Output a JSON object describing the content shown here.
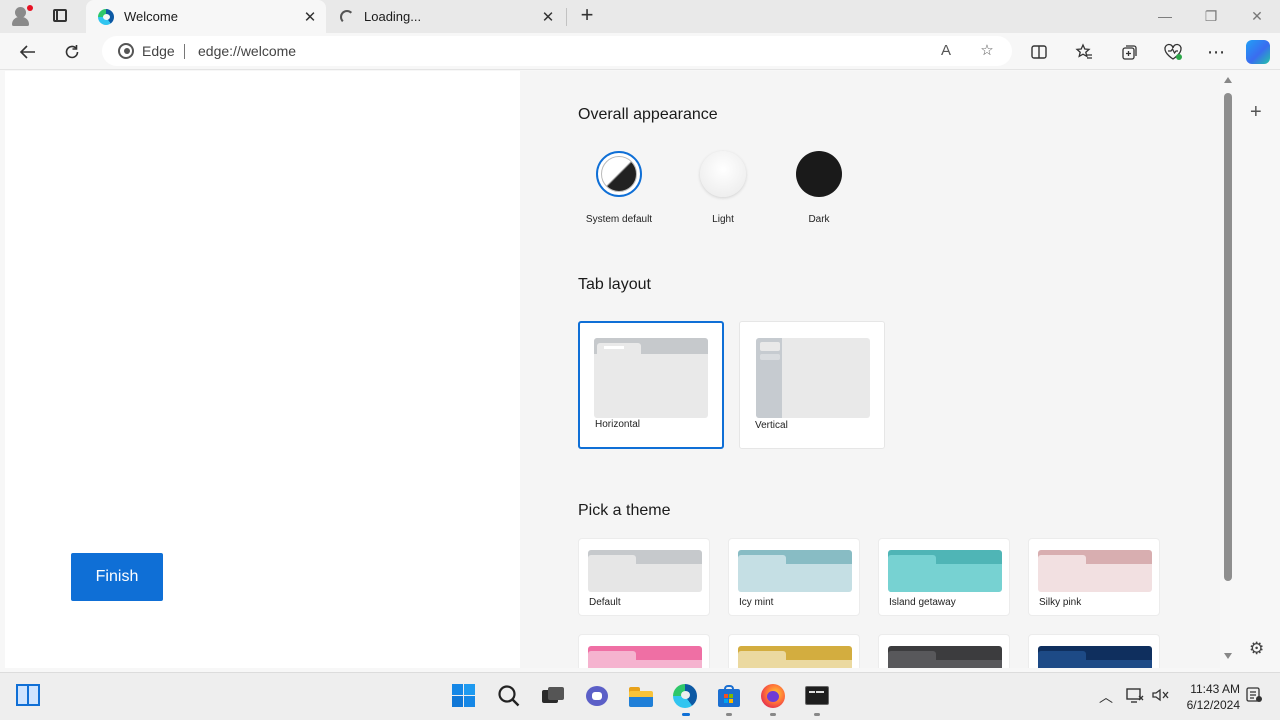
{
  "browser": {
    "tabs": [
      {
        "title": "Welcome",
        "active": true
      },
      {
        "title": "Loading...",
        "active": false
      }
    ],
    "address": {
      "brand": "Edge",
      "url": "edge://welcome"
    },
    "accent": "#0f6fd6"
  },
  "left": {
    "finish_label": "Finish"
  },
  "right": {
    "appearance": {
      "title": "Overall appearance",
      "options": [
        {
          "label": "System default",
          "selected": true
        },
        {
          "label": "Light",
          "selected": false
        },
        {
          "label": "Dark",
          "selected": false
        }
      ]
    },
    "tab_layout": {
      "title": "Tab layout",
      "options": [
        {
          "label": "Horizontal",
          "selected": true
        },
        {
          "label": "Vertical",
          "selected": false
        }
      ]
    },
    "themes": {
      "title": "Pick a theme",
      "options": [
        {
          "label": "Default",
          "top": "#c6c9cc",
          "tab": "#e6e6e6",
          "body": "#e6e6e6"
        },
        {
          "label": "Icy mint",
          "top": "#88bcc4",
          "tab": "#c5dfe4",
          "body": "#c5dfe4"
        },
        {
          "label": "Island getaway",
          "top": "#4fb5b6",
          "tab": "#77d2d2",
          "body": "#77d2d2"
        },
        {
          "label": "Silky pink",
          "top": "#d8aeb0",
          "tab": "#f2e0e1",
          "body": "#f2e0e1"
        },
        {
          "label": "",
          "top": "#ef6fa4",
          "tab": "#f5b3cf",
          "body": "#f5b3cf"
        },
        {
          "label": "",
          "top": "#d3ad3f",
          "tab": "#ebd9a0",
          "body": "#ebd9a0"
        },
        {
          "label": "",
          "top": "#3c3c3e",
          "tab": "#58585b",
          "body": "#58585b"
        },
        {
          "label": "",
          "top": "#0f2f5e",
          "tab": "#1d4a86",
          "body": "#1d4a86"
        }
      ]
    }
  },
  "taskbar": {
    "time": "11:43 AM",
    "date": "6/12/2024"
  }
}
